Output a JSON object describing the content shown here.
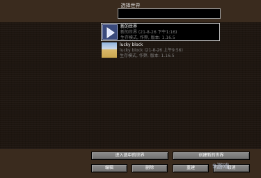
{
  "screen": {
    "title": "选择世界"
  },
  "search": {
    "value": ""
  },
  "worlds": [
    {
      "name": "新的世界",
      "line1": "新的世界 (21-8-26 下午1:16)",
      "line2": "生存模式, 作弊, 版本: 1.16.5",
      "icon": "play-arrow-icon",
      "selected": true
    },
    {
      "name": "lucky block",
      "line1": "lucky block (21-8-26 上午9:56)",
      "line2": "生存模式, 作弊, 版本: 1.16.5",
      "icon": "desert-thumbnail",
      "selected": false
    }
  ],
  "buttons": {
    "play": "进入选中的世界",
    "create": "创建新的世界",
    "edit": "编辑",
    "delete": "删除",
    "recreate": "重建",
    "cancel": "取消"
  },
  "watermark": "9游戏"
}
